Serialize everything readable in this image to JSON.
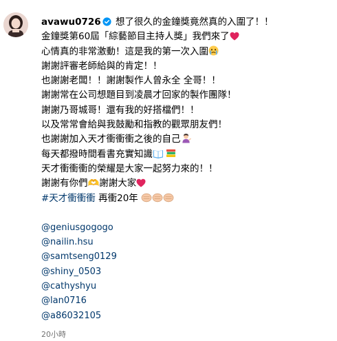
{
  "post": {
    "username": "avawu0726",
    "lines": [
      "想了很久的金鐘獎竟然真的入圍了！！",
      "金鐘獎第60屆「綜藝節目主持人獎」我們來了",
      "心情真的非常激動！這是我的第一次入圍",
      "謝謝評審老師給與的肯定！！",
      "也謝謝老闆！！謝謝製作人曾永全 全哥！！",
      "謝謝常在公司想題目到凌晨才回家的製作團隊！",
      "謝謝乃哥城哥！還有我的好搭檔們！！",
      "以及常常會給與我鼓勵和指教的觀眾朋友們！",
      "也謝謝加入天才衝衝衝之後的自己",
      "每天都撥時間看書充實知識",
      "天才衝衝衝的榮耀是大家一起努力來的！！",
      "謝謝有你們🫶謝謝大家"
    ],
    "hashtag": "#天才衝衝衝",
    "hashtag_suffix": " 再衝20年",
    "mentions": [
      "@geniusgogogo",
      "@nailin.hsu",
      "@samtseng0129",
      "@shiny_0503",
      "@cathyshyu",
      "@lan0716",
      "@a86032105"
    ],
    "timestamp": "20小時"
  },
  "icons": {
    "verified": "verified-badge-icon",
    "heart": "red-heart-emoji",
    "crying": "crying-face-emoji",
    "person": "person-tipping-hand-emoji",
    "book": "open-book-emoji",
    "books": "books-emoji",
    "fist": "oncoming-fist-emoji"
  },
  "colors": {
    "link": "#00376b",
    "verified": "#0095f6",
    "timestamp": "#737373",
    "heart": "#e0245e"
  }
}
